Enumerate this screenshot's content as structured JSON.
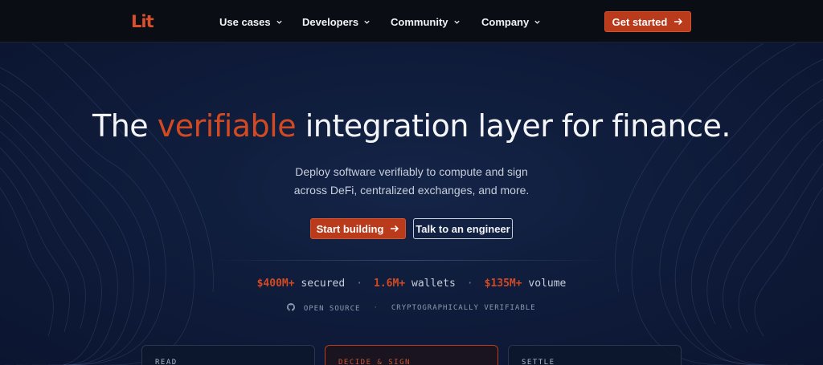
{
  "nav": {
    "logo": "Lit",
    "items": [
      {
        "label": "Use cases"
      },
      {
        "label": "Developers"
      },
      {
        "label": "Community"
      },
      {
        "label": "Company"
      }
    ],
    "cta_label": "Get started"
  },
  "hero": {
    "title_accent": "verifiable",
    "title_pre": "The",
    "title_post": "integration layer for finance.",
    "subtitle_line1": "Deploy software verifiably to compute and sign",
    "subtitle_line2": "across DeFi, centralized exchanges, and more.",
    "primary_button": "Start building",
    "secondary_button": "Talk to an engineer"
  },
  "stats": [
    {
      "value": "$400M+",
      "label": "secured"
    },
    {
      "value": "1.6M+",
      "label": "wallets"
    },
    {
      "value": "$135M+",
      "label": "volume"
    }
  ],
  "badges": {
    "open_source": "OPEN SOURCE",
    "verifiable": "CRYPTOGRAPHICALLY VERIFIABLE"
  },
  "cards": [
    {
      "label": "READ"
    },
    {
      "label": "DECIDE & SIGN"
    },
    {
      "label": "SETTLE"
    }
  ],
  "colors": {
    "accent": "#d24a22",
    "button": "#b93b1c",
    "nav_bg": "#0a0d14",
    "hero_bg": "#0f1c3b"
  }
}
